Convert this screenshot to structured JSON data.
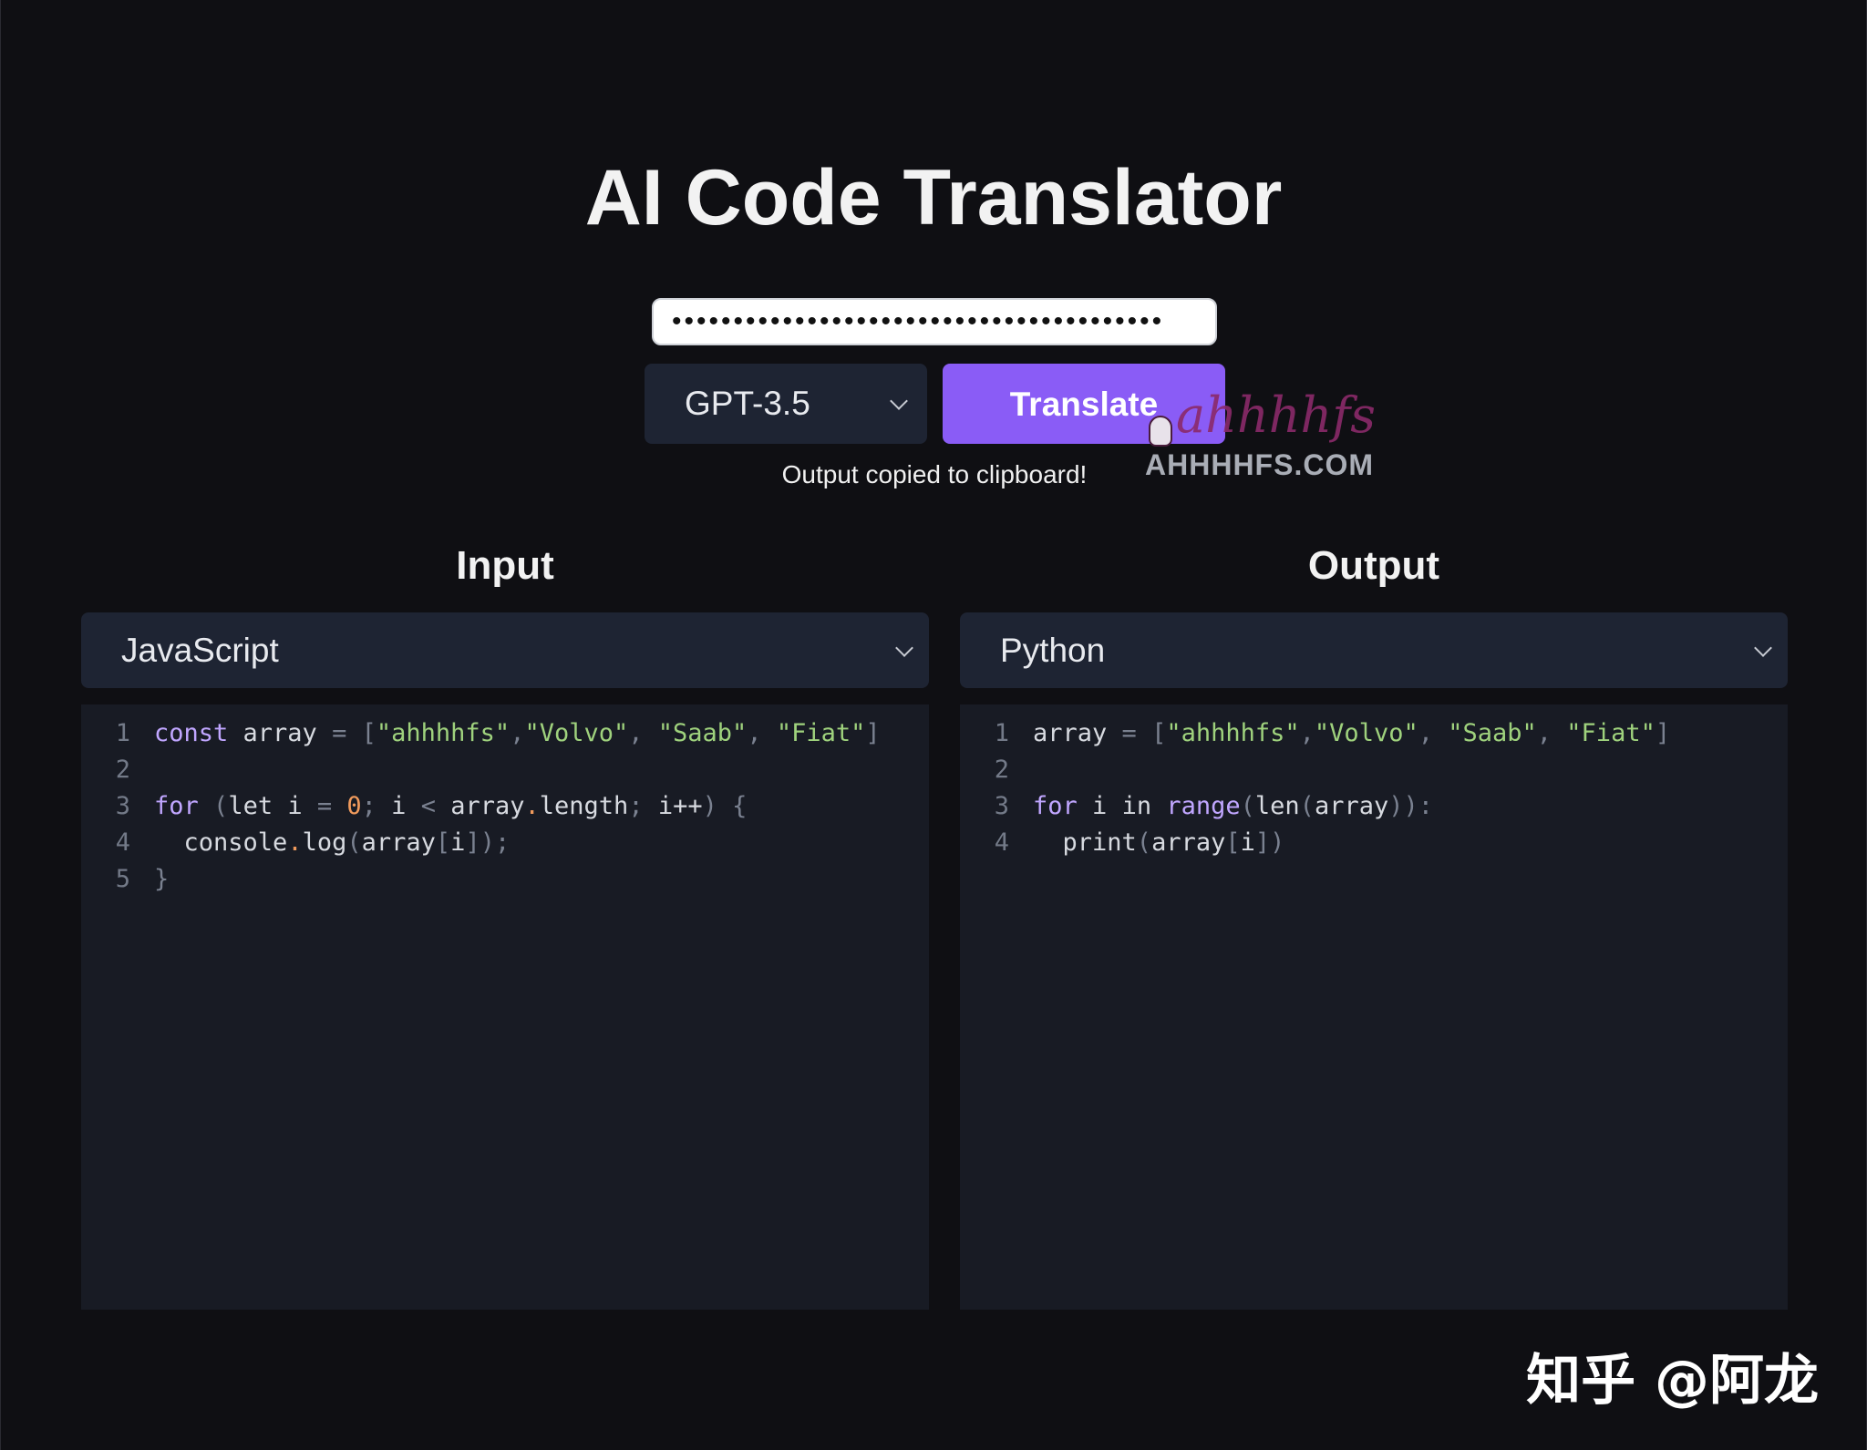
{
  "app": {
    "title": "AI Code Translator"
  },
  "api_key": {
    "masked_value": "••••••••••••••••••••••••••••••••••••••••"
  },
  "model_select": {
    "selected": "GPT-3.5"
  },
  "translate_button": {
    "label": "Translate"
  },
  "status": {
    "message": "Output copied to clipboard!"
  },
  "watermark": {
    "script_text": "ahhhhfs",
    "url_text": "AHHHHFS.COM"
  },
  "input": {
    "label": "Input",
    "language": "JavaScript",
    "line_numbers": [
      "1",
      "2",
      "3",
      "4",
      "5"
    ],
    "lines": [
      [
        {
          "t": "const",
          "c": "kw"
        },
        {
          "t": " array ",
          "c": ""
        },
        {
          "t": "=",
          "c": "pn"
        },
        {
          "t": " ",
          "c": ""
        },
        {
          "t": "[",
          "c": "pn"
        },
        {
          "t": "\"ahhhhfs\"",
          "c": "str"
        },
        {
          "t": ",",
          "c": "pn"
        },
        {
          "t": "\"Volvo\"",
          "c": "str"
        },
        {
          "t": ", ",
          "c": "pn"
        },
        {
          "t": "\"Saab\"",
          "c": "str"
        },
        {
          "t": ", ",
          "c": "pn"
        },
        {
          "t": "\"Fiat\"",
          "c": "str"
        },
        {
          "t": "]",
          "c": "pn"
        }
      ],
      [],
      [
        {
          "t": "for",
          "c": "kw"
        },
        {
          "t": " ",
          "c": ""
        },
        {
          "t": "(",
          "c": "pn"
        },
        {
          "t": "let i ",
          "c": ""
        },
        {
          "t": "=",
          "c": "pn"
        },
        {
          "t": " ",
          "c": ""
        },
        {
          "t": "0",
          "c": "num"
        },
        {
          "t": ";",
          "c": "pn"
        },
        {
          "t": " i ",
          "c": ""
        },
        {
          "t": "<",
          "c": "pn"
        },
        {
          "t": " array",
          "c": ""
        },
        {
          "t": ".",
          "c": "num"
        },
        {
          "t": "length",
          "c": ""
        },
        {
          "t": ";",
          "c": "pn"
        },
        {
          "t": " i++",
          "c": ""
        },
        {
          "t": ")",
          "c": "pn"
        },
        {
          "t": " {",
          "c": "pn"
        }
      ],
      [
        {
          "t": "  console",
          "c": ""
        },
        {
          "t": ".",
          "c": "num"
        },
        {
          "t": "log",
          "c": ""
        },
        {
          "t": "(",
          "c": "pn"
        },
        {
          "t": "array",
          "c": ""
        },
        {
          "t": "[",
          "c": "pn"
        },
        {
          "t": "i",
          "c": ""
        },
        {
          "t": "]",
          "c": "pn"
        },
        {
          "t": ")",
          "c": "pn"
        },
        {
          "t": ";",
          "c": "pn"
        }
      ],
      [
        {
          "t": "}",
          "c": "pn"
        }
      ]
    ]
  },
  "output": {
    "label": "Output",
    "language": "Python",
    "line_numbers": [
      "1",
      "2",
      "3",
      "4"
    ],
    "lines": [
      [
        {
          "t": "array ",
          "c": ""
        },
        {
          "t": "=",
          "c": "pn"
        },
        {
          "t": " ",
          "c": ""
        },
        {
          "t": "[",
          "c": "pn"
        },
        {
          "t": "\"ahhhhfs\"",
          "c": "str"
        },
        {
          "t": ",",
          "c": "pn"
        },
        {
          "t": "\"Volvo\"",
          "c": "str"
        },
        {
          "t": ", ",
          "c": "pn"
        },
        {
          "t": "\"Saab\"",
          "c": "str"
        },
        {
          "t": ", ",
          "c": "pn"
        },
        {
          "t": "\"Fiat\"",
          "c": "str"
        },
        {
          "t": "]",
          "c": "pn"
        }
      ],
      [],
      [
        {
          "t": "for",
          "c": "kw"
        },
        {
          "t": " i ",
          "c": ""
        },
        {
          "t": "in",
          "c": ""
        },
        {
          "t": " ",
          "c": ""
        },
        {
          "t": "range",
          "c": "fn"
        },
        {
          "t": "(",
          "c": "pn"
        },
        {
          "t": "len",
          "c": ""
        },
        {
          "t": "(",
          "c": "pn"
        },
        {
          "t": "array",
          "c": ""
        },
        {
          "t": ")",
          "c": "pn"
        },
        {
          "t": ")",
          "c": "pn"
        },
        {
          "t": ":",
          "c": "pn"
        }
      ],
      [
        {
          "t": "  print",
          "c": ""
        },
        {
          "t": "(",
          "c": "pn"
        },
        {
          "t": "array",
          "c": ""
        },
        {
          "t": "[",
          "c": "pn"
        },
        {
          "t": "i",
          "c": ""
        },
        {
          "t": "]",
          "c": "pn"
        },
        {
          "t": ")",
          "c": "pn"
        }
      ]
    ]
  },
  "footer": {
    "watermark": "知乎 @阿龙"
  },
  "colors": {
    "background": "#0f0f13",
    "panel": "#1e2433",
    "editor": "#181b24",
    "accent": "#8a5cf6",
    "keyword": "#c0a6ff",
    "string": "#9fd27d",
    "number": "#f09a5c"
  },
  "icons": {
    "model_select": "chevron-down-icon",
    "input_language": "chevron-down-icon",
    "output_language": "chevron-down-icon"
  }
}
